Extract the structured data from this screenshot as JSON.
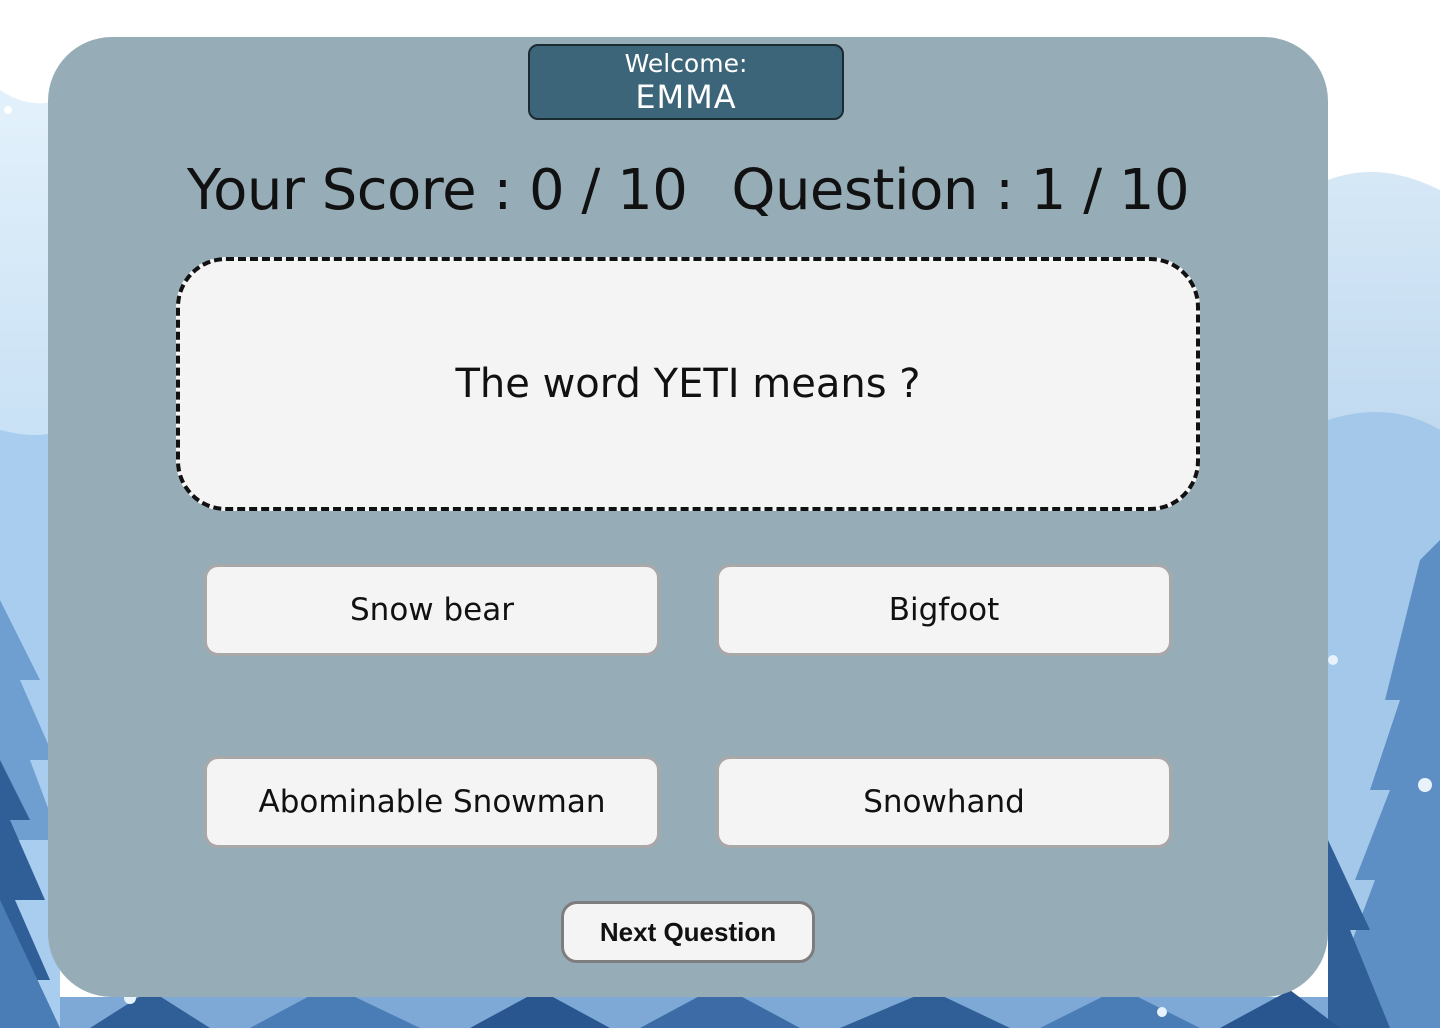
{
  "welcome": {
    "label": "Welcome:",
    "name": "EMMA"
  },
  "score": {
    "score_text": "Your Score : 0 / 10",
    "question_text": "Question : 1 / 10"
  },
  "question": {
    "text": "The word YETI means ?"
  },
  "answers": [
    "Snow bear",
    "Bigfoot",
    "Abominable Snowman",
    "Snowhand"
  ],
  "controls": {
    "next_label": "Next Question"
  },
  "colors": {
    "panel": "#96adb7",
    "welcome_bg": "#3d6579",
    "card_bg": "#f4f4f4",
    "sky": "#cfe6f5",
    "tree_light": "#6f9fd0",
    "tree_dark": "#2f5f96"
  }
}
